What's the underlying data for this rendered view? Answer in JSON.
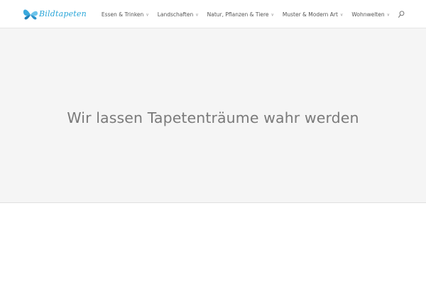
{
  "header": {
    "logo_text": "Bildtapeten",
    "nav": [
      {
        "label": "Essen & Trinken",
        "caret": "∨"
      },
      {
        "label": "Landschaften",
        "caret": "∨"
      },
      {
        "label": "Natur, Pflanzen & Tiere",
        "caret": "∨"
      },
      {
        "label": "Muster & Modern Art",
        "caret": "∨"
      },
      {
        "label": "Wohnwelten",
        "caret": "∨"
      }
    ]
  },
  "hero": {
    "title": "Wir lassen Tapetenträume wahr werden"
  },
  "colors": {
    "brand": "#2aa6d8",
    "hero_background": "#f5f5f5",
    "hero_text": "#7a7a7a"
  }
}
